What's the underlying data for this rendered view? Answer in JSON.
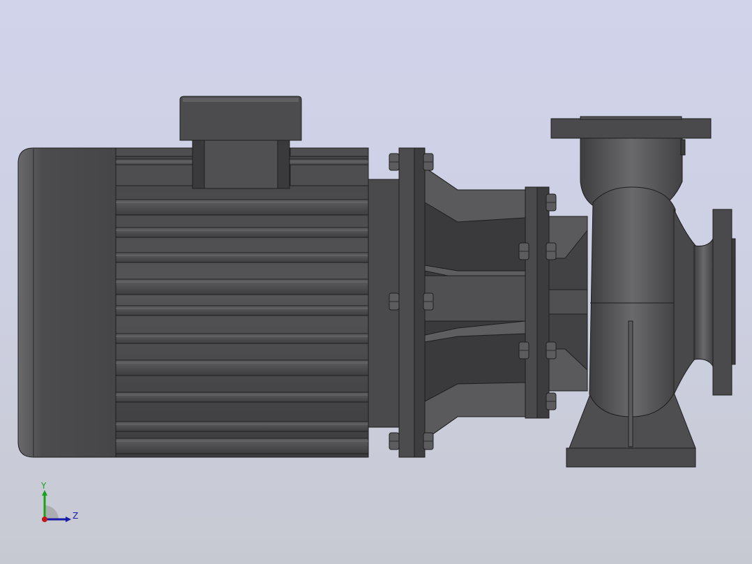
{
  "viewport": {
    "background_top": "#d1d3eb",
    "background_bottom": "#c7c9d2"
  },
  "model": {
    "description_icon": "centrifugal-pump-motor-model",
    "body_color": "#4a4a4c",
    "highlight_color": "#6e6e70",
    "edge_color": "#1e1e1e"
  },
  "triad": {
    "y_label": "Y",
    "z_label": "Z",
    "y_color": "#1aa31a",
    "z_color": "#1a1aa8",
    "x_color": "#c01818"
  }
}
